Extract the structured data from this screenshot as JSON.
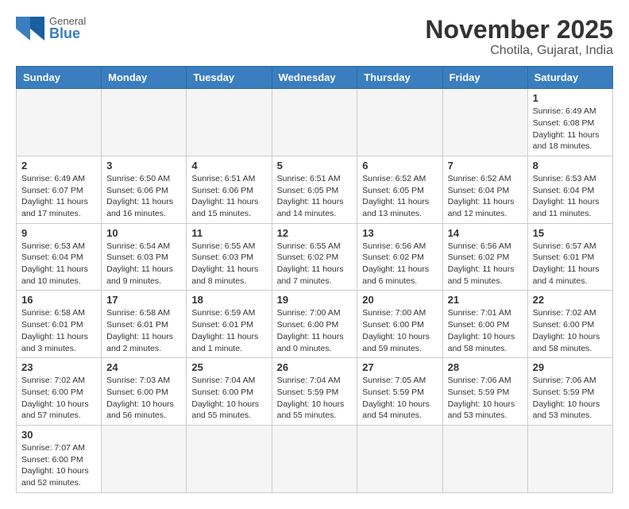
{
  "logo": {
    "text_general": "General",
    "text_blue": "Blue"
  },
  "title": "November 2025",
  "location": "Chotila, Gujarat, India",
  "days_of_week": [
    "Sunday",
    "Monday",
    "Tuesday",
    "Wednesday",
    "Thursday",
    "Friday",
    "Saturday"
  ],
  "weeks": [
    [
      {
        "day": "",
        "info": ""
      },
      {
        "day": "",
        "info": ""
      },
      {
        "day": "",
        "info": ""
      },
      {
        "day": "",
        "info": ""
      },
      {
        "day": "",
        "info": ""
      },
      {
        "day": "",
        "info": ""
      },
      {
        "day": "1",
        "info": "Sunrise: 6:49 AM\nSunset: 6:08 PM\nDaylight: 11 hours\nand 18 minutes."
      }
    ],
    [
      {
        "day": "2",
        "info": "Sunrise: 6:49 AM\nSunset: 6:07 PM\nDaylight: 11 hours\nand 17 minutes."
      },
      {
        "day": "3",
        "info": "Sunrise: 6:50 AM\nSunset: 6:06 PM\nDaylight: 11 hours\nand 16 minutes."
      },
      {
        "day": "4",
        "info": "Sunrise: 6:51 AM\nSunset: 6:06 PM\nDaylight: 11 hours\nand 15 minutes."
      },
      {
        "day": "5",
        "info": "Sunrise: 6:51 AM\nSunset: 6:05 PM\nDaylight: 11 hours\nand 14 minutes."
      },
      {
        "day": "6",
        "info": "Sunrise: 6:52 AM\nSunset: 6:05 PM\nDaylight: 11 hours\nand 13 minutes."
      },
      {
        "day": "7",
        "info": "Sunrise: 6:52 AM\nSunset: 6:04 PM\nDaylight: 11 hours\nand 12 minutes."
      },
      {
        "day": "8",
        "info": "Sunrise: 6:53 AM\nSunset: 6:04 PM\nDaylight: 11 hours\nand 11 minutes."
      }
    ],
    [
      {
        "day": "9",
        "info": "Sunrise: 6:53 AM\nSunset: 6:04 PM\nDaylight: 11 hours\nand 10 minutes."
      },
      {
        "day": "10",
        "info": "Sunrise: 6:54 AM\nSunset: 6:03 PM\nDaylight: 11 hours\nand 9 minutes."
      },
      {
        "day": "11",
        "info": "Sunrise: 6:55 AM\nSunset: 6:03 PM\nDaylight: 11 hours\nand 8 minutes."
      },
      {
        "day": "12",
        "info": "Sunrise: 6:55 AM\nSunset: 6:02 PM\nDaylight: 11 hours\nand 7 minutes."
      },
      {
        "day": "13",
        "info": "Sunrise: 6:56 AM\nSunset: 6:02 PM\nDaylight: 11 hours\nand 6 minutes."
      },
      {
        "day": "14",
        "info": "Sunrise: 6:56 AM\nSunset: 6:02 PM\nDaylight: 11 hours\nand 5 minutes."
      },
      {
        "day": "15",
        "info": "Sunrise: 6:57 AM\nSunset: 6:01 PM\nDaylight: 11 hours\nand 4 minutes."
      }
    ],
    [
      {
        "day": "16",
        "info": "Sunrise: 6:58 AM\nSunset: 6:01 PM\nDaylight: 11 hours\nand 3 minutes."
      },
      {
        "day": "17",
        "info": "Sunrise: 6:58 AM\nSunset: 6:01 PM\nDaylight: 11 hours\nand 2 minutes."
      },
      {
        "day": "18",
        "info": "Sunrise: 6:59 AM\nSunset: 6:01 PM\nDaylight: 11 hours\nand 1 minute."
      },
      {
        "day": "19",
        "info": "Sunrise: 7:00 AM\nSunset: 6:00 PM\nDaylight: 11 hours\nand 0 minutes."
      },
      {
        "day": "20",
        "info": "Sunrise: 7:00 AM\nSunset: 6:00 PM\nDaylight: 10 hours\nand 59 minutes."
      },
      {
        "day": "21",
        "info": "Sunrise: 7:01 AM\nSunset: 6:00 PM\nDaylight: 10 hours\nand 58 minutes."
      },
      {
        "day": "22",
        "info": "Sunrise: 7:02 AM\nSunset: 6:00 PM\nDaylight: 10 hours\nand 58 minutes."
      }
    ],
    [
      {
        "day": "23",
        "info": "Sunrise: 7:02 AM\nSunset: 6:00 PM\nDaylight: 10 hours\nand 57 minutes."
      },
      {
        "day": "24",
        "info": "Sunrise: 7:03 AM\nSunset: 6:00 PM\nDaylight: 10 hours\nand 56 minutes."
      },
      {
        "day": "25",
        "info": "Sunrise: 7:04 AM\nSunset: 6:00 PM\nDaylight: 10 hours\nand 55 minutes."
      },
      {
        "day": "26",
        "info": "Sunrise: 7:04 AM\nSunset: 5:59 PM\nDaylight: 10 hours\nand 55 minutes."
      },
      {
        "day": "27",
        "info": "Sunrise: 7:05 AM\nSunset: 5:59 PM\nDaylight: 10 hours\nand 54 minutes."
      },
      {
        "day": "28",
        "info": "Sunrise: 7:06 AM\nSunset: 5:59 PM\nDaylight: 10 hours\nand 53 minutes."
      },
      {
        "day": "29",
        "info": "Sunrise: 7:06 AM\nSunset: 5:59 PM\nDaylight: 10 hours\nand 53 minutes."
      }
    ],
    [
      {
        "day": "30",
        "info": "Sunrise: 7:07 AM\nSunset: 6:00 PM\nDaylight: 10 hours\nand 52 minutes."
      },
      {
        "day": "",
        "info": ""
      },
      {
        "day": "",
        "info": ""
      },
      {
        "day": "",
        "info": ""
      },
      {
        "day": "",
        "info": ""
      },
      {
        "day": "",
        "info": ""
      },
      {
        "day": "",
        "info": ""
      }
    ]
  ]
}
